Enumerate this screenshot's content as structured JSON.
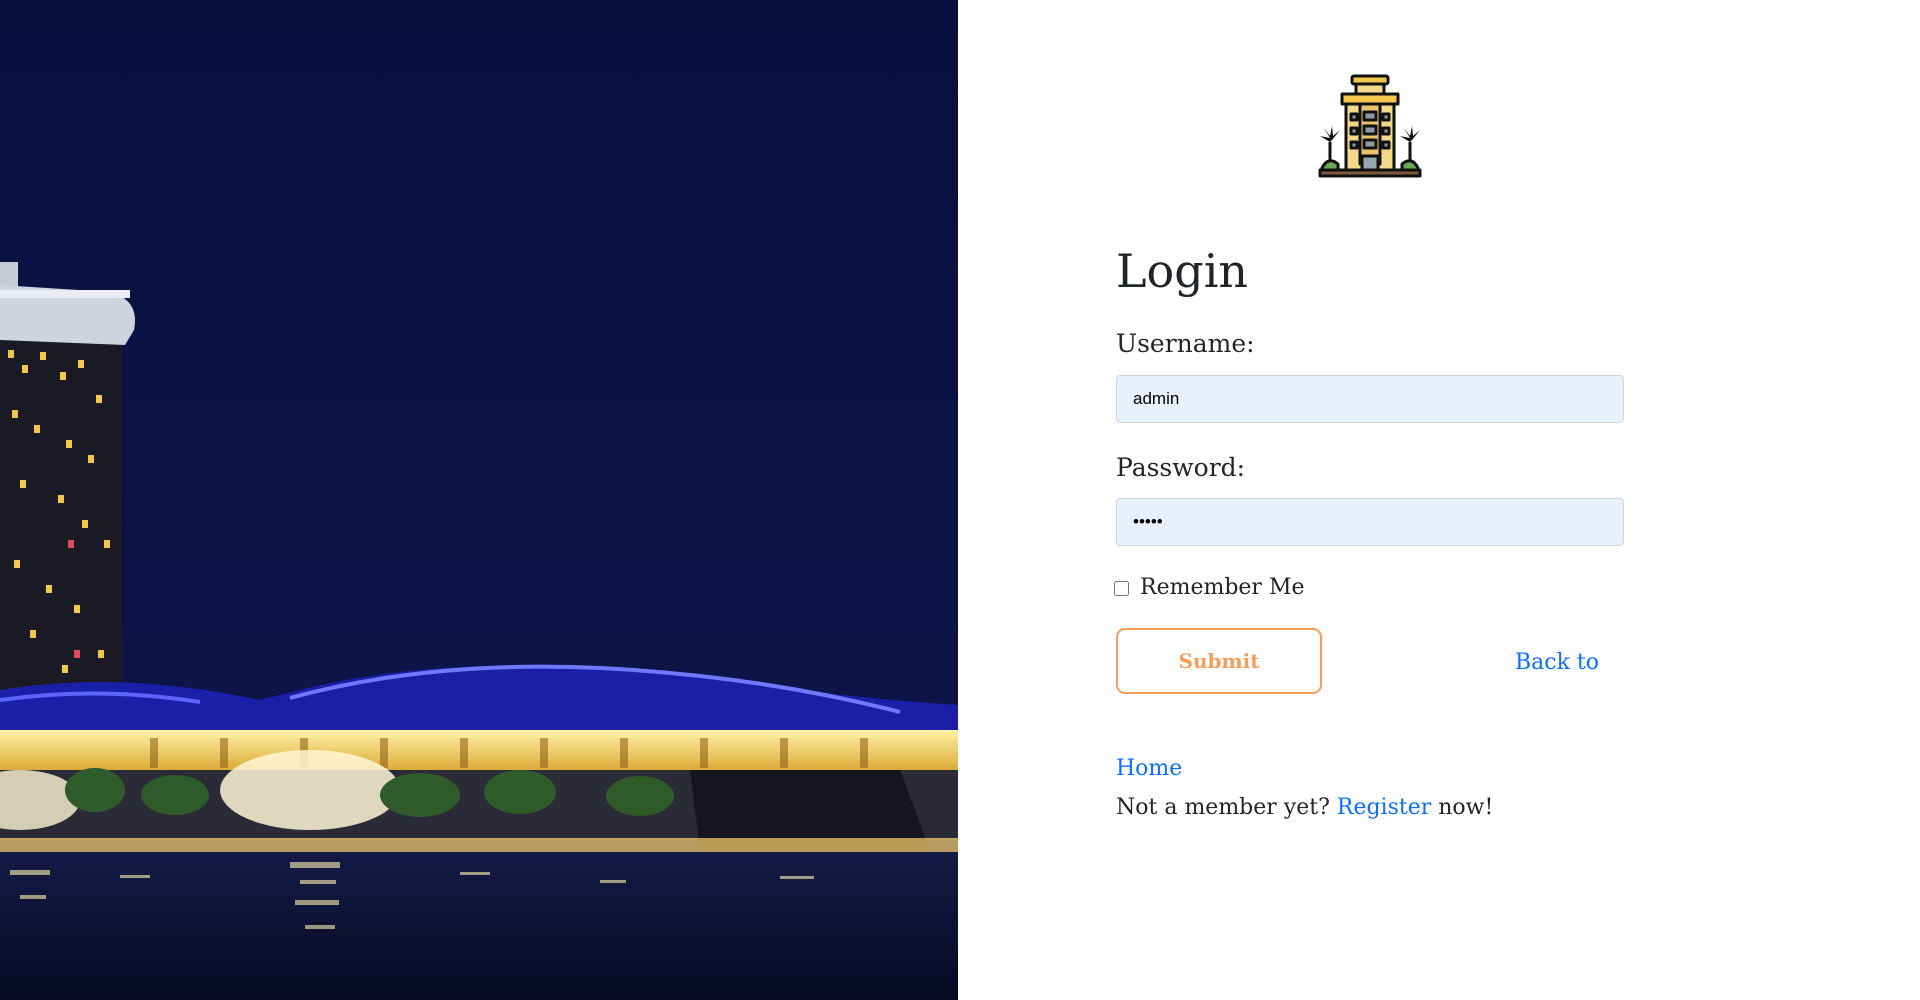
{
  "hero": {
    "image": "marina-bay-skyline-at-night",
    "colors": {
      "sky": "#0b1445",
      "lights": "#ffe27a",
      "accent_blue": "#2b33d6",
      "water": "#0d1230"
    }
  },
  "logo": {
    "icon": "hotel-building-icon"
  },
  "form": {
    "title": "Login",
    "username_label": "Username:",
    "username_value": "admin",
    "password_label": "Password:",
    "password_value": "•••••",
    "remember_label": "Remember Me",
    "remember_checked": false,
    "submit_label": "Submit",
    "back_link": "Back to",
    "home_link": "Home",
    "register_prefix": "Not a member yet?",
    "register_link": "Register",
    "register_suffix": "now!"
  },
  "colors": {
    "accent_orange": "#f79d5c",
    "link_blue": "#0d6efd",
    "input_background": "#e8f0fe",
    "text": "#212529"
  }
}
